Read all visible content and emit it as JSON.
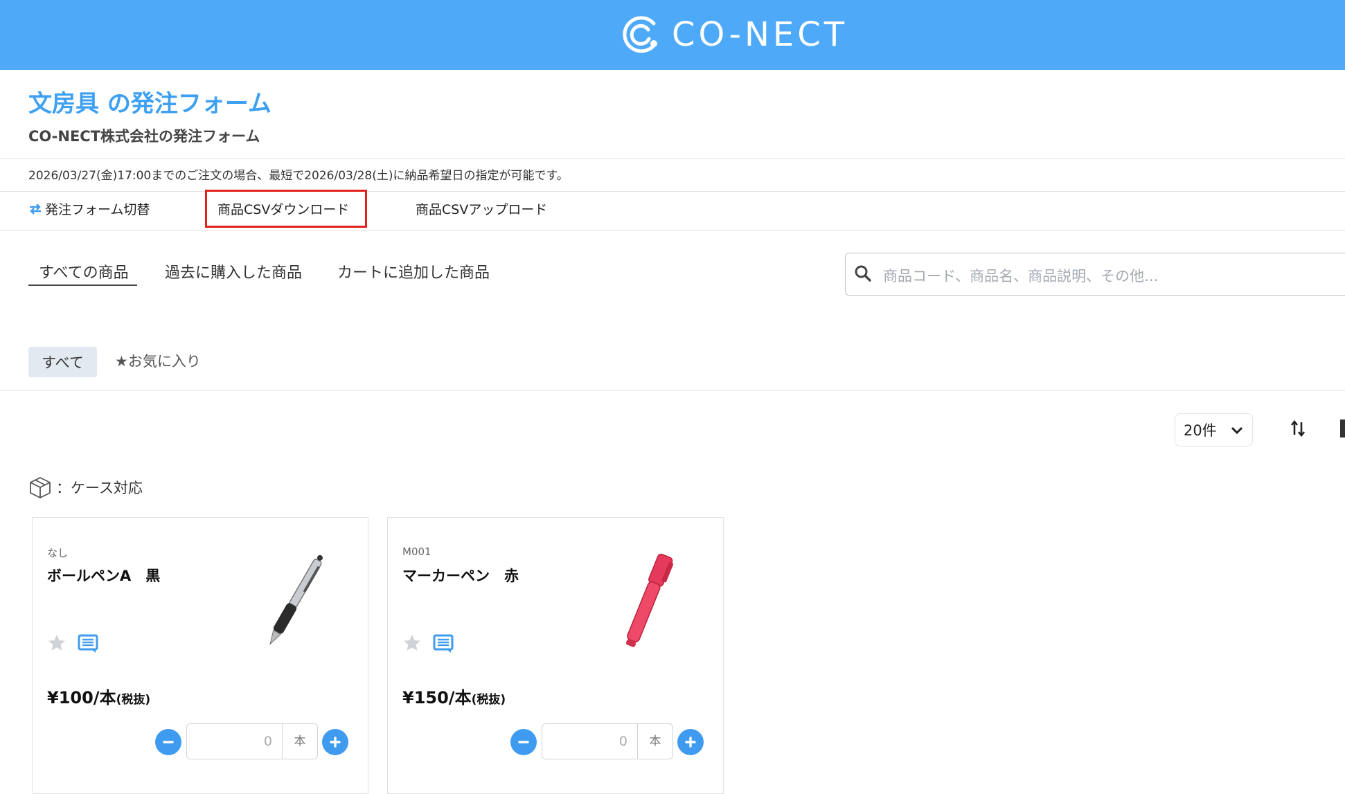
{
  "header": {
    "brand": "CO-NECT",
    "bg_color": "#4eaaf9"
  },
  "page": {
    "title": "文房具 の発注フォーム",
    "subtitle": "CO-NECT株式会社の発注フォーム",
    "notice": "2026/03/27(金)17:00までのご注文の場合、最短で2026/03/28(土)に納品希望日の指定が可能です。"
  },
  "actions": {
    "switch_form": "発注フォーム切替",
    "csv_download": "商品CSVダウンロード",
    "csv_upload": "商品CSVアップロード"
  },
  "tabs": [
    {
      "label": "すべての商品",
      "active": true
    },
    {
      "label": "過去に購入した商品",
      "active": false
    },
    {
      "label": "カートに追加した商品",
      "active": false
    }
  ],
  "search": {
    "placeholder": "商品コード、商品名、商品説明、その他..."
  },
  "filters": {
    "all": "すべて",
    "favorites": "★お気に入り"
  },
  "toolbar": {
    "per_page": "20件"
  },
  "legend": {
    "case_label": "：ケース対応"
  },
  "products": [
    {
      "code": "なし",
      "name": "ボールペンA　黒",
      "price": "¥100/本",
      "tax_note": "(税抜)",
      "quantity": "0",
      "unit": "本",
      "icon": "ballpoint-pen-icon"
    },
    {
      "code": "M001",
      "name": "マーカーペン　赤",
      "price": "¥150/本",
      "tax_note": "(税抜)",
      "quantity": "0",
      "unit": "本",
      "icon": "marker-pen-icon"
    }
  ],
  "colors": {
    "accent": "#3da0f2",
    "button": "#3f9bef",
    "highlight_border": "#e3201b"
  }
}
